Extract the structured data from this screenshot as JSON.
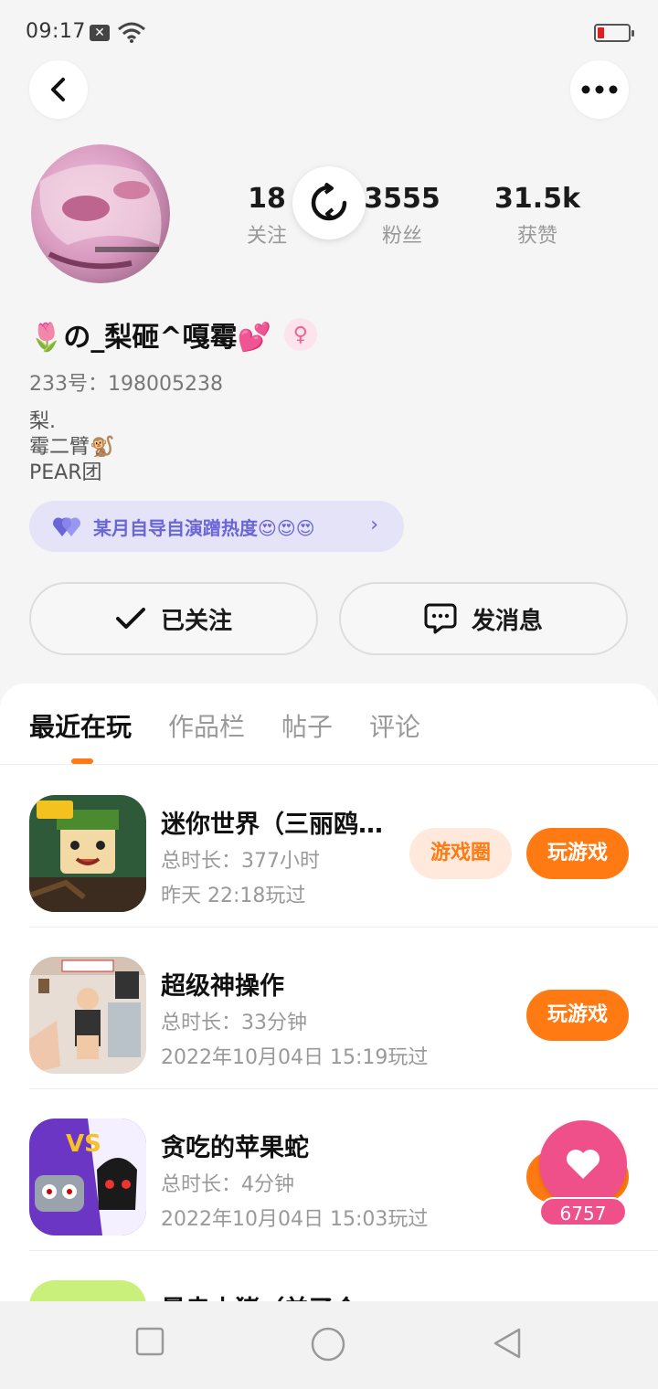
{
  "status_bar": {
    "time": "09:17",
    "sim_glyph": "✕"
  },
  "profile": {
    "stats": [
      {
        "value": "18",
        "label": "关注"
      },
      {
        "value": "3555",
        "label": "粉丝"
      },
      {
        "value": "31.5k",
        "label": "获赞"
      }
    ],
    "nickname": "🌷の_梨砸^嘎霉💕",
    "gender_symbol": "♀",
    "uid": "233号：198005238",
    "bio_lines": [
      "梨.",
      "霉二臂🐒",
      "PEAR团"
    ],
    "heat_pill": "某月自导自演蹭热度😍😍😍",
    "heat_chevron": "›",
    "follow_label": "已关注",
    "message_label": "发消息"
  },
  "tabs": [
    "最近在玩",
    "作品栏",
    "帖子",
    "评论"
  ],
  "games": [
    {
      "title": "迷你世界（三丽鸥…",
      "duration": "总时长：377小时",
      "last_played": "昨天 22:18玩过",
      "circle_label": "游戏圈",
      "play_label": "玩游戏"
    },
    {
      "title": "超级神操作",
      "duration": "总时长：33分钟",
      "last_played": "2022年10月04日 15:19玩过",
      "play_label": "玩游戏"
    },
    {
      "title": "贪吃的苹果蛇",
      "duration": "总时长：4分钟",
      "last_played": "2022年10月04日 15:03玩过",
      "play_label": "玩游戏"
    },
    {
      "title": "暴走小猪（羊了个羊）"
    }
  ],
  "floating_like": {
    "count": "6757"
  },
  "colors": {
    "accent": "#ff7a12",
    "like": "#f0508a",
    "heat": "#6a66d8"
  }
}
